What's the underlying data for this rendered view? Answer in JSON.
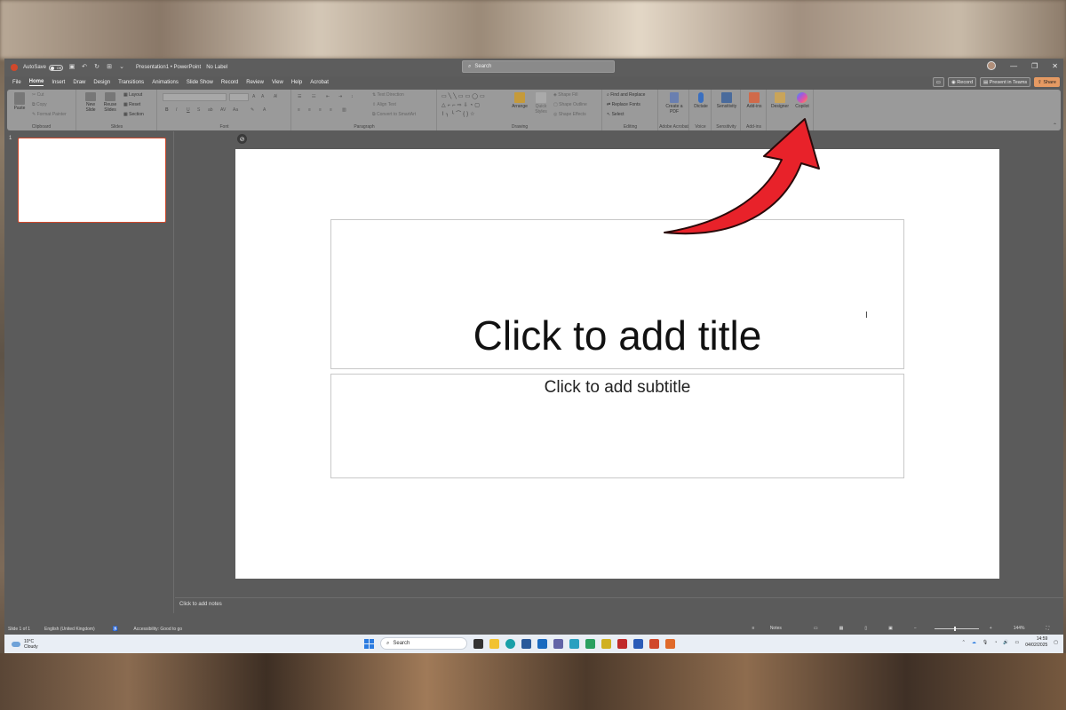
{
  "titlebar": {
    "autosave_label": "AutoSave",
    "autosave_state": "Off",
    "document_title": "Presentation1 • PowerPoint",
    "sensitivity_label": "No Label",
    "search_placeholder": "Search"
  },
  "menu": {
    "items": [
      "File",
      "Home",
      "Insert",
      "Draw",
      "Design",
      "Transitions",
      "Animations",
      "Slide Show",
      "Record",
      "Review",
      "View",
      "Help",
      "Acrobat"
    ],
    "active": "Home",
    "record_label": "Record",
    "present_label": "Present in Teams",
    "share_label": "Share"
  },
  "ribbon": {
    "clipboard": {
      "paste": "Paste",
      "cut": "Cut",
      "copy": "Copy",
      "format_painter": "Format Painter",
      "label": "Clipboard"
    },
    "slides": {
      "new_slide": "New Slide",
      "reuse": "Reuse Slides",
      "layout": "Layout",
      "reset": "Reset",
      "section": "Section",
      "label": "Slides"
    },
    "font": {
      "label": "Font"
    },
    "paragraph": {
      "text_direction": "Text Direction",
      "align_text": "Align Text",
      "smartart": "Convert to SmartArt",
      "label": "Paragraph"
    },
    "drawing": {
      "arrange": "Arrange",
      "quick_styles": "Quick Styles",
      "shape_fill": "Shape Fill",
      "shape_outline": "Shape Outline",
      "shape_effects": "Shape Effects",
      "label": "Drawing"
    },
    "editing": {
      "find_replace": "Find and Replace",
      "replace_fonts": "Replace Fonts",
      "select": "Select",
      "label": "Editing"
    },
    "acrobat": {
      "create_pdf": "Create a PDF",
      "label": "Adobe Acrobat"
    },
    "voice": {
      "dictate": "Dictate",
      "label": "Voice"
    },
    "sensitivity": {
      "button": "Sensitivity",
      "label": "Sensitivity"
    },
    "addins": {
      "button": "Add-ins",
      "label": "Add-ins"
    },
    "designer": "Designer",
    "copilot": "Copilot"
  },
  "slides_pane": {
    "slide_number": "1"
  },
  "slide": {
    "title_placeholder": "Click to add title",
    "subtitle_placeholder": "Click to add subtitle"
  },
  "notes_placeholder": "Click to add notes",
  "statusbar": {
    "slide_count": "Slide 1 of 1",
    "language": "English (United Kingdom)",
    "accessibility": "Accessibility: Good to go",
    "notes": "Notes",
    "zoom": "144%"
  },
  "taskbar": {
    "temperature": "10°C",
    "weather": "Cloudy",
    "search": "Search",
    "time": "14:59",
    "date": "04/02/2025"
  },
  "colors": {
    "accent": "#d0482b",
    "arrow": "#e8222a",
    "share": "#e59a63"
  }
}
